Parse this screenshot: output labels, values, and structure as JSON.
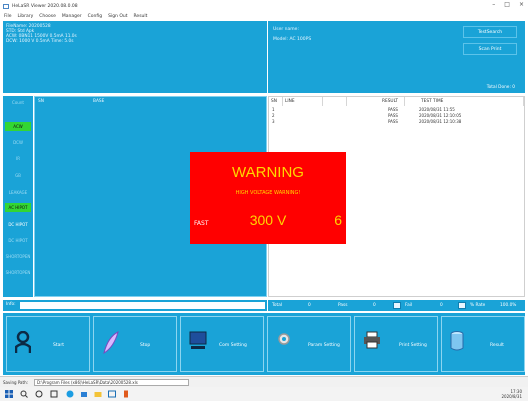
{
  "window": {
    "title": "HeLaSR Viewer 2020.08.0.08",
    "controls": [
      "–",
      "□",
      "×"
    ]
  },
  "menu": [
    "File",
    "Library",
    "Choose",
    "Manager",
    "Config",
    "Sign Out",
    "Result"
  ],
  "info": {
    "lines": [
      "FileName: 20200528",
      "STD: Std Apk",
      "ACW: 0BN11  1500V 0.5mA  11.0s",
      "DCW: 1000 V  0.5mA  Time: 5.0s"
    ]
  },
  "user": {
    "name_label": "User name:",
    "model_label": "Model: AC 100PS",
    "buttons": [
      "TestSearch",
      "Scan Print"
    ],
    "total": "Total Done: 0"
  },
  "steps": [
    "Count",
    "ACW",
    "DCW",
    "IR",
    "GB",
    "LEAKAGE",
    "AC HIPOT",
    "DC HIPOT",
    "DC HIPOT",
    "SHORTOPEN",
    "SHORTOPEN"
  ],
  "chart_header": [
    "SN",
    "BASE"
  ],
  "results": {
    "headers": [
      "SN",
      "LINE",
      "RESULT",
      "TEST TIME"
    ],
    "rows": [
      {
        "sn": "1",
        "result": "PASS",
        "time": "2020/08/31 11:55"
      },
      {
        "sn": "2",
        "result": "PASS",
        "time": "2020/08/31 12:10:05"
      },
      {
        "sn": "3",
        "result": "PASS",
        "time": "2020/08/31 12:10:38"
      }
    ]
  },
  "warning": {
    "title": "WARNING",
    "subtitle": "HIGH VOLTAGE WARNING!",
    "mode": "FAST",
    "voltage": "300 V",
    "count": "6"
  },
  "progress": {
    "label": "Info:"
  },
  "stats": {
    "total_label": "Total",
    "total_value": "0",
    "pass_label": "Pass",
    "pass_value": "0",
    "fail_label": "Fail",
    "fail_value": "0",
    "rate_label": "% Rate",
    "rate_value": "100.0%"
  },
  "actions": [
    {
      "label": "Start",
      "icon": "user-icon"
    },
    {
      "label": "Stop",
      "icon": "feather-icon"
    },
    {
      "label": "Com Setting",
      "icon": "monitor-icon"
    },
    {
      "label": "Param Setting",
      "icon": "gear-icon"
    },
    {
      "label": "Print Setting",
      "icon": "printer-icon"
    },
    {
      "label": "Result",
      "icon": "database-icon"
    }
  ],
  "status": {
    "label": "Saving Path:",
    "path": "D:\\Program Files (x86)\\HeLaSR\\Data\\20200528.xls"
  },
  "tray": {
    "time": "17:30",
    "date": "2020/8/31"
  },
  "colors": {
    "panel": "#1aa3d7",
    "warning_bg": "#ff0000",
    "warning_text": "#ffd700",
    "active_step": "#33d633"
  }
}
